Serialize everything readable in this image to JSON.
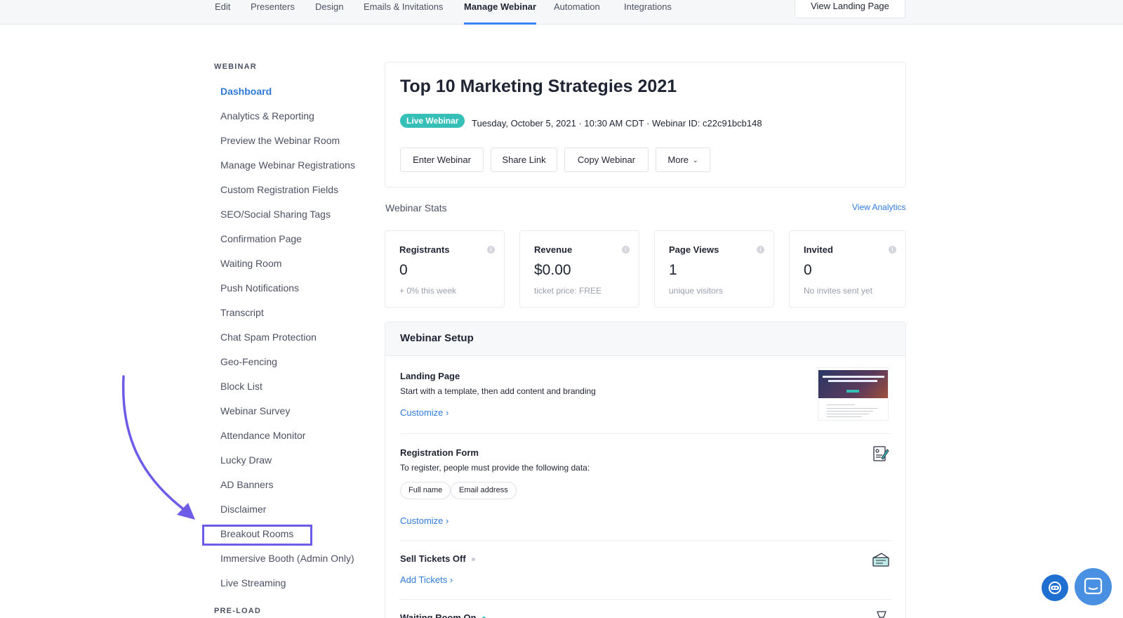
{
  "topnav": {
    "tabs": [
      {
        "label": "Edit"
      },
      {
        "label": "Presenters"
      },
      {
        "label": "Design"
      },
      {
        "label": "Emails & Invitations"
      },
      {
        "label": "Manage Webinar"
      },
      {
        "label": "Automation"
      },
      {
        "label": "Integrations"
      }
    ],
    "active_tab": "Manage Webinar",
    "view_landing": "View Landing Page"
  },
  "sidebar": {
    "heading": "WEBINAR",
    "items": [
      "Dashboard",
      "Analytics & Reporting",
      "Preview the Webinar Room",
      "Manage Webinar Registrations",
      "Custom Registration Fields",
      "SEO/Social Sharing Tags",
      "Confirmation Page",
      "Waiting Room",
      "Push Notifications",
      "Transcript",
      "Chat Spam Protection",
      "Geo-Fencing",
      "Block List",
      "Webinar Survey",
      "Attendance Monitor",
      "Lucky Draw",
      "AD Banners",
      "Disclaimer",
      "Breakout Rooms",
      "Immersive Booth (Admin Only)",
      "Live Streaming"
    ],
    "active_item": "Dashboard",
    "highlighted_item": "Breakout Rooms",
    "heading2": "PRE-LOAD"
  },
  "webinar": {
    "title": "Top 10 Marketing Strategies 2021",
    "badge": "Live Webinar",
    "meta": "Tuesday, October 5, 2021 · 10:30 AM CDT · Webinar ID: c22c91bcb148",
    "actions": [
      "Enter Webinar",
      "Share Link",
      "Copy Webinar",
      "More"
    ]
  },
  "stats": {
    "label": "Webinar Stats",
    "view_analytics": "View Analytics",
    "cards": [
      {
        "label": "Registrants",
        "value": "0",
        "sub": "+ 0% this week"
      },
      {
        "label": "Revenue",
        "value": "$0.00",
        "sub": "ticket price: FREE"
      },
      {
        "label": "Page Views",
        "value": "1",
        "sub": "unique visitors"
      },
      {
        "label": "Invited",
        "value": "0",
        "sub": "No invites sent yet"
      }
    ]
  },
  "setup": {
    "heading": "Webinar Setup",
    "landing": {
      "title": "Landing Page",
      "desc": "Start with a template, then add content and branding",
      "link": "Customize"
    },
    "registration": {
      "title": "Registration Form",
      "desc": "To register, people must provide the following data:",
      "fields": [
        "Full name",
        "Email address"
      ],
      "link": "Customize"
    },
    "tickets": {
      "title": "Sell Tickets Off",
      "link": "Add Tickets"
    },
    "waiting": {
      "title": "Waiting Room On"
    }
  },
  "colors": {
    "accent": "#2f7ad9",
    "badge": "#35bfb7",
    "highlight": "#6c5ce7"
  }
}
